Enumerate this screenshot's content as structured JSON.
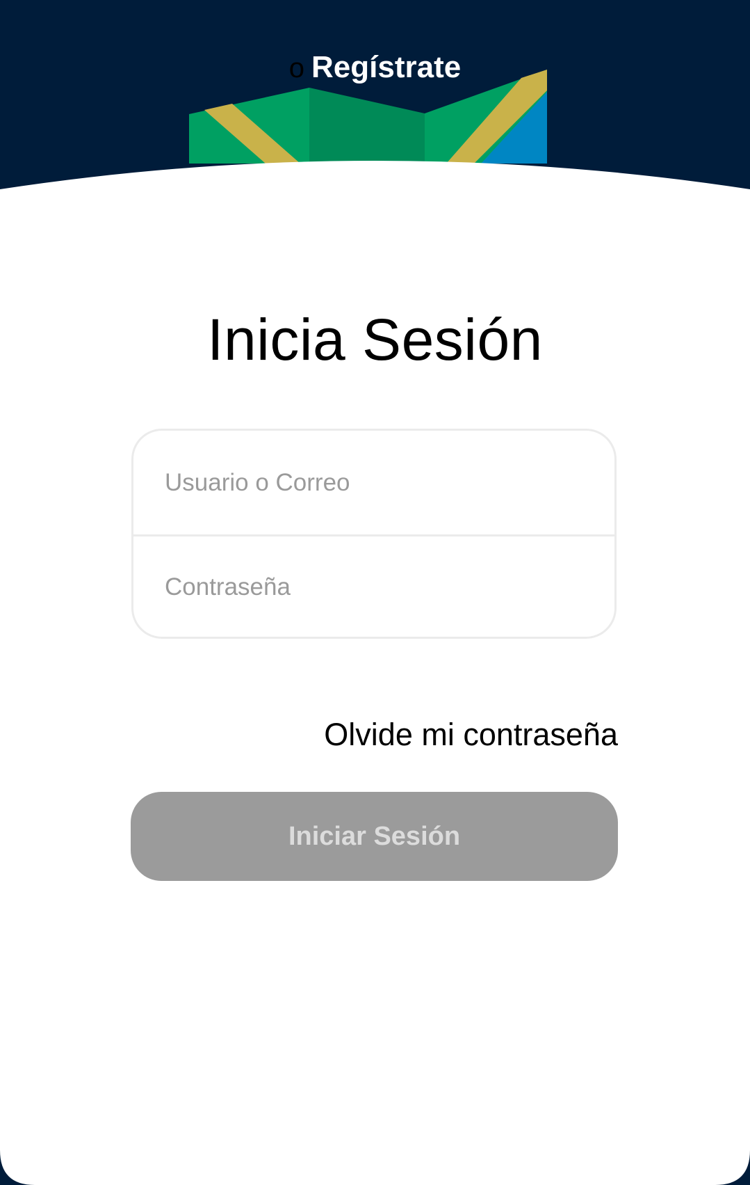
{
  "header": {
    "prefix": "o",
    "register_label": "Regístrate"
  },
  "login": {
    "title": "Inicia Sesión",
    "username_placeholder": "Usuario o Correo",
    "password_placeholder": "Contraseña",
    "forgot_label": "Olvide mi contraseña",
    "submit_label": "Iniciar Sesión"
  },
  "colors": {
    "header_background": "#001c3a",
    "card_background": "#ffffff",
    "button_disabled": "#9b9b9b",
    "map_green": "#00a062",
    "map_dark_green": "#008a57",
    "map_gold": "#c9b24a",
    "map_blue": "#0086c3"
  },
  "icons": {
    "map": "folded-map-illustration"
  }
}
